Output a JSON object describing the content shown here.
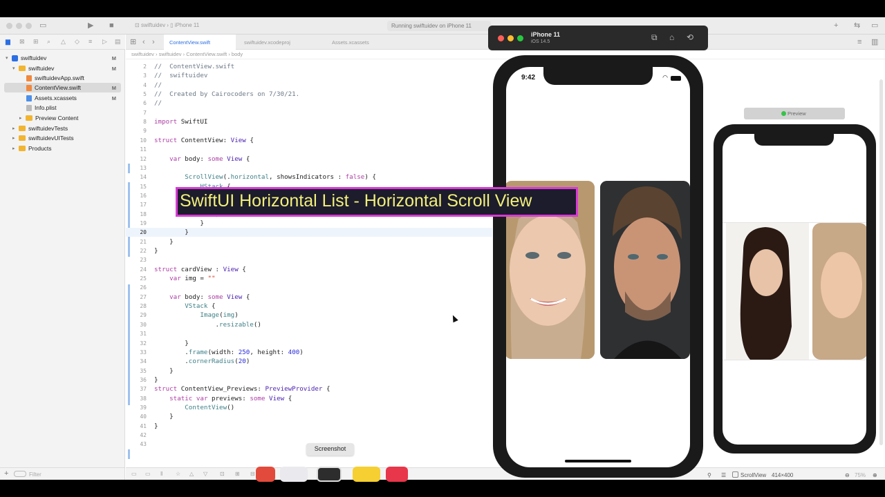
{
  "toolbar": {
    "project": "swiftuidev",
    "device": "iPhone 11",
    "status": "Running swiftuidev on iPhone 11"
  },
  "tabs": [
    {
      "label": "ContentView.swift",
      "active": true
    },
    {
      "label": "swiftuidev.xcodeproj",
      "active": false
    },
    {
      "label": "Assets.xcassets",
      "active": false
    }
  ],
  "breadcrumb": "swiftuidev  ›  swiftuidev  ›  ContentView.swift  ›  body",
  "navigator": {
    "items": [
      {
        "label": "swiftuidev",
        "badge": "M",
        "kind": "project"
      },
      {
        "label": "swiftuidev",
        "badge": "M",
        "kind": "folder"
      },
      {
        "label": "swiftuidevApp.swift",
        "badge": "",
        "kind": "swift"
      },
      {
        "label": "ContentView.swift",
        "badge": "M",
        "kind": "swift"
      },
      {
        "label": "Assets.xcassets",
        "badge": "M",
        "kind": "assets"
      },
      {
        "label": "Info.plist",
        "badge": "",
        "kind": "plist"
      },
      {
        "label": "Preview Content",
        "badge": "",
        "kind": "folder"
      },
      {
        "label": "swiftuidevTests",
        "badge": "",
        "kind": "folder"
      },
      {
        "label": "swiftuidevUITests",
        "badge": "",
        "kind": "folder"
      },
      {
        "label": "Products",
        "badge": "",
        "kind": "folder"
      }
    ],
    "filter_placeholder": "Filter"
  },
  "code": {
    "lines": [
      {
        "n": "2",
        "html": "<span class='c'>//  ContentView.swift</span>"
      },
      {
        "n": "3",
        "html": "<span class='c'>//  swiftuidev</span>"
      },
      {
        "n": "4",
        "html": "<span class='c'>//</span>"
      },
      {
        "n": "5",
        "html": "<span class='c'>//  Created by Cairocoders on 7/30/21.</span>"
      },
      {
        "n": "6",
        "html": "<span class='c'>//</span>"
      },
      {
        "n": "7",
        "html": ""
      },
      {
        "n": "8",
        "html": "<span class='k'>import</span> SwiftUI"
      },
      {
        "n": "9",
        "html": ""
      },
      {
        "n": "10",
        "html": "<span class='k'>struct</span> ContentView: <span class='t'>View</span> {"
      },
      {
        "n": "11",
        "html": ""
      },
      {
        "n": "12",
        "html": "    <span class='k'>var</span> body: <span class='k'>some</span> <span class='t'>View</span> {"
      },
      {
        "n": "13",
        "html": ""
      },
      {
        "n": "14",
        "html": "        <span class='f'>ScrollView</span>(.<span class='f'>horizontal</span>, showsIndicators : <span class='k'>false</span>) {"
      },
      {
        "n": "15",
        "html": "            <span class='f'>HStack</span> {"
      },
      {
        "n": "16",
        "html": ""
      },
      {
        "n": "17",
        "html": ""
      },
      {
        "n": "18",
        "html": "                }"
      },
      {
        "n": "19",
        "html": "            }"
      },
      {
        "n": "20",
        "html": "        }"
      },
      {
        "n": "21",
        "html": "    }"
      },
      {
        "n": "22",
        "html": "}"
      },
      {
        "n": "23",
        "html": ""
      },
      {
        "n": "24",
        "html": "<span class='k'>struct</span> cardView : <span class='t'>View</span> {"
      },
      {
        "n": "25",
        "html": "    <span class='k'>var</span> img = <span class='s'>\"\"</span>"
      },
      {
        "n": "26",
        "html": ""
      },
      {
        "n": "27",
        "html": "    <span class='k'>var</span> body: <span class='k'>some</span> <span class='t'>View</span> {"
      },
      {
        "n": "28",
        "html": "        <span class='f'>VStack</span> {"
      },
      {
        "n": "29",
        "html": "            <span class='f'>Image</span>(<span class='f'>img</span>)"
      },
      {
        "n": "30",
        "html": "                .<span class='f'>resizable</span>()"
      },
      {
        "n": "31",
        "html": ""
      },
      {
        "n": "32",
        "html": "        }"
      },
      {
        "n": "33",
        "html": "        .<span class='f'>frame</span>(width: <span class='n'>250</span>, height: <span class='n'>400</span>)"
      },
      {
        "n": "34",
        "html": "        .<span class='f'>cornerRadius</span>(<span class='n'>20</span>)"
      },
      {
        "n": "35",
        "html": "    }"
      },
      {
        "n": "36",
        "html": "}"
      },
      {
        "n": "37",
        "html": "<span class='k'>struct</span> ContentView_Previews: <span class='t'>PreviewProvider</span> {"
      },
      {
        "n": "38",
        "html": "    <span class='k'>static</span> <span class='k'>var</span> previews: <span class='k'>some</span> <span class='t'>View</span> {"
      },
      {
        "n": "39",
        "html": "        <span class='f'>ContentView</span>()"
      },
      {
        "n": "40",
        "html": "    }"
      },
      {
        "n": "41",
        "html": "}"
      },
      {
        "n": "42",
        "html": ""
      },
      {
        "n": "43",
        "html": ""
      }
    ],
    "current_line": "20"
  },
  "banner": "SwiftUI Horizontal List - Horizontal Scroll View",
  "simulator": {
    "device": "iPhone 11",
    "os": "iOS 14.5",
    "time": "9:42"
  },
  "preview": {
    "label": "Preview",
    "footer_item": "ScrollView",
    "footer_size": "414×400",
    "zoom": "75%"
  },
  "tooltip": "Screenshot"
}
